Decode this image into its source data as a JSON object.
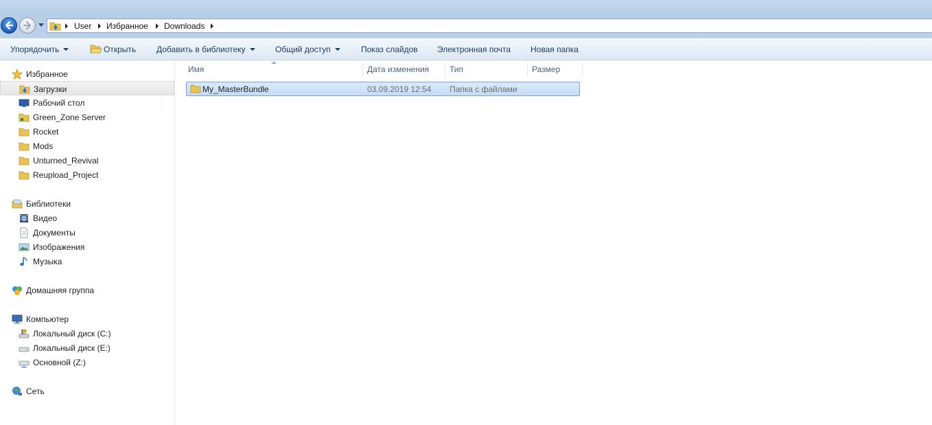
{
  "address": {
    "crumbs": [
      "User",
      "Избранное",
      "Downloads"
    ]
  },
  "toolbar": {
    "organize": "Упорядочить",
    "open": "Открыть",
    "add_to_library": "Добавить в библиотеку",
    "share": "Общий доступ",
    "slideshow": "Показ слайдов",
    "email": "Электронная почта",
    "new_folder": "Новая папка"
  },
  "nav": {
    "favorites": {
      "label": "Избранное",
      "items": [
        "Загрузки",
        "Рабочий стол",
        "Green_Zone Server",
        "Rocket",
        "Mods",
        "Unturned_Revival",
        "Reupload_Project"
      ]
    },
    "libraries": {
      "label": "Библиотеки",
      "items": [
        "Видео",
        "Документы",
        "Изображения",
        "Музыка"
      ]
    },
    "homegroup": {
      "label": "Домашняя группа"
    },
    "computer": {
      "label": "Компьютер",
      "items": [
        "Локальный диск (C:)",
        "Локальный диск (E:)",
        "Основной (Z:)"
      ]
    },
    "network": {
      "label": "Сеть"
    }
  },
  "columns": {
    "name": "Имя",
    "date": "Дата изменения",
    "type": "Тип",
    "size": "Размер"
  },
  "files": [
    {
      "name": "My_MasterBundle",
      "date": "03.09.2019 12:54",
      "type": "Папка с файлами",
      "size": ""
    }
  ],
  "colors": {
    "selection": "#cce0f7",
    "toolbar_text": "#1e395b",
    "header_text": "#4c607a",
    "folder": "#e8c25a"
  }
}
